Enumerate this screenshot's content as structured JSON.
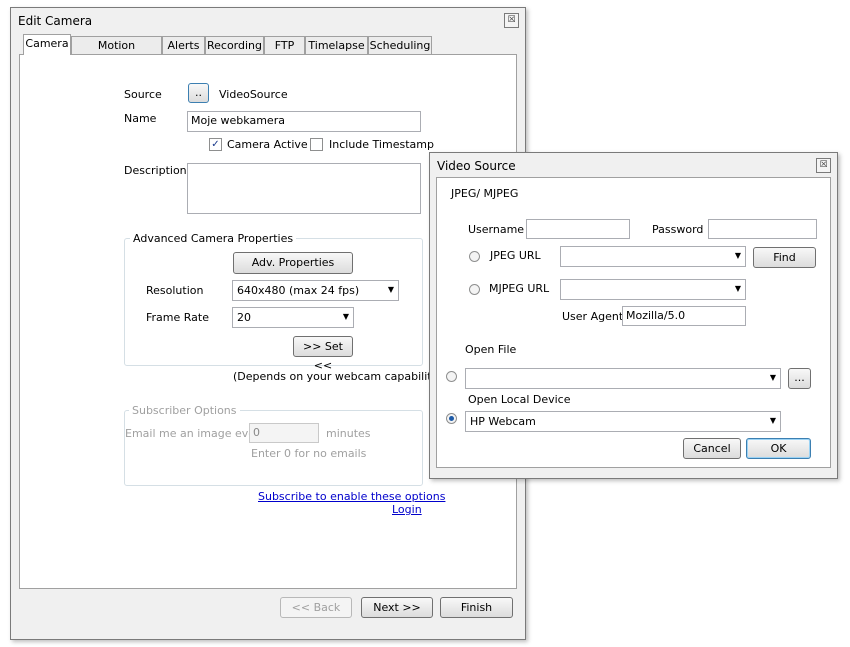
{
  "edit_camera": {
    "title": "Edit Camera",
    "close_glyph": "☒",
    "tabs": [
      "Camera",
      "Motion Detection",
      "Alerts",
      "Recording",
      "FTP",
      "Timelapse",
      "Scheduling"
    ],
    "source_label": "Source",
    "source_button": "..",
    "source_value": "VideoSource",
    "name_label": "Name",
    "name_value": "Moje webkamera",
    "camera_active_label": "Camera Active",
    "camera_active_checked": true,
    "include_timestamp_label": "Include Timestamp",
    "include_timestamp_checked": false,
    "description_label": "Description",
    "description_value": "",
    "advanced": {
      "group_label": "Advanced Camera Properties",
      "adv_button": "Adv. Properties",
      "resolution_label": "Resolution",
      "resolution_value": "640x480 (max 24 fps)",
      "frame_rate_label": "Frame Rate",
      "frame_rate_value": "20",
      "set_button": ">> Set <<"
    },
    "depends_note": "(Depends on your webcam capabilities)",
    "subscriber": {
      "group_label": "Subscriber Options",
      "email_label": "Email me an image every",
      "email_value": "0",
      "minutes_label": "minutes",
      "hint": "Enter 0 for no emails"
    },
    "subscribe_link": "Subscribe to enable these options",
    "login_link": "Login",
    "back_button": "<< Back",
    "next_button": "Next >>",
    "finish_button": "Finish"
  },
  "video_source": {
    "title": "Video Source",
    "close_glyph": "☒",
    "section_title": "JPEG/ MJPEG",
    "username_label": "Username",
    "username_value": "",
    "password_label": "Password",
    "password_value": "",
    "jpeg_url_label": "JPEG URL",
    "jpeg_url_value": "",
    "find_button": "Find",
    "mjpeg_url_label": "MJPEG URL",
    "mjpeg_url_value": "",
    "user_agent_label": "User Agent",
    "user_agent_value": "Mozilla/5.0",
    "open_file_label": "Open File",
    "open_file_value": "",
    "browse_button": "...",
    "local_device_label": "Open Local Device",
    "local_device_value": "HP Webcam",
    "cancel_button": "Cancel",
    "ok_button": "OK"
  }
}
